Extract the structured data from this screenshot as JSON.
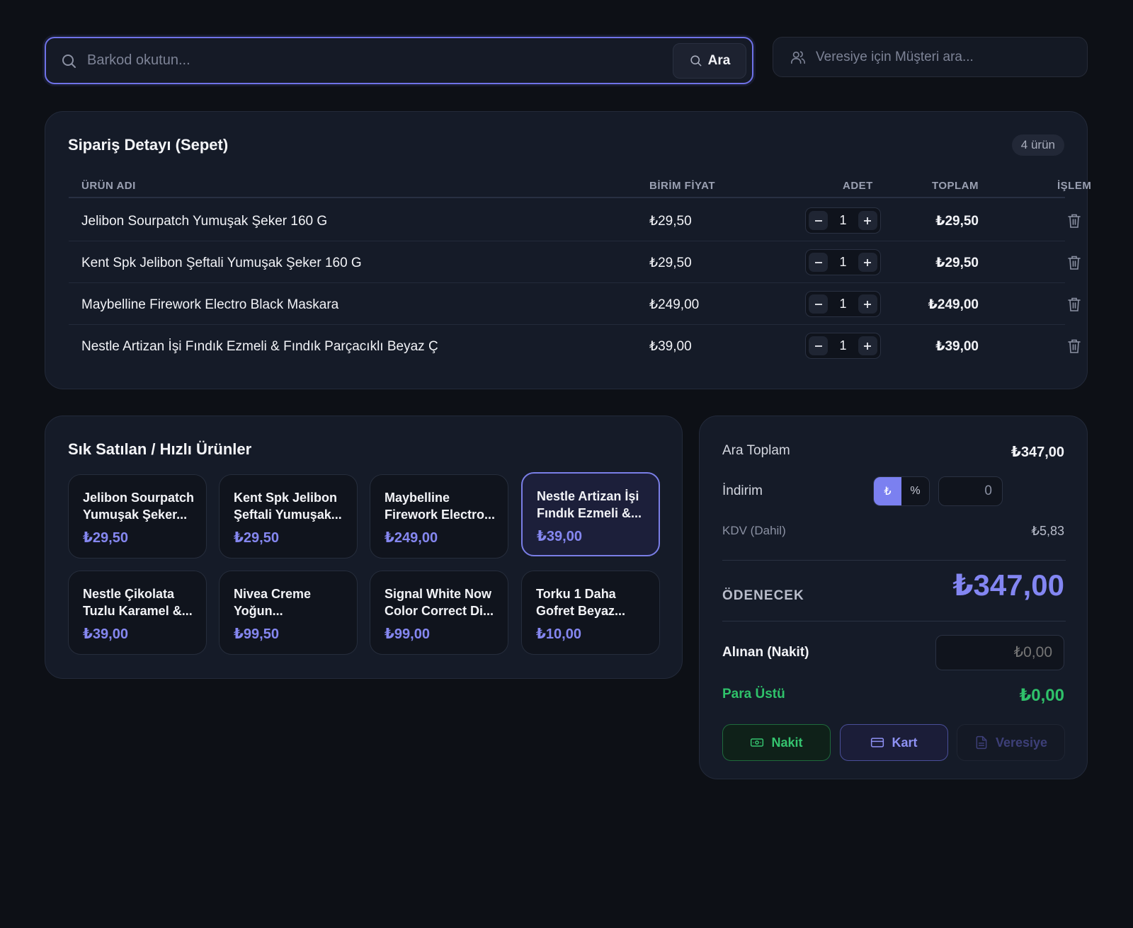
{
  "search": {
    "placeholder": "Barkod okutun...",
    "button_label": "Ara"
  },
  "customer": {
    "placeholder": "Veresiye için Müşteri ara..."
  },
  "cart": {
    "title": "Sipariş Detayı (Sepet)",
    "count_label": "4 ürün",
    "columns": {
      "name": "ÜRÜN ADI",
      "unit_price": "BİRİM FİYAT",
      "qty": "ADET",
      "total": "TOPLAM",
      "action": "İŞLEM"
    },
    "rows": [
      {
        "name": "Jelibon Sourpatch Yumuşak Şeker 160 G",
        "unit_price": "₺29,50",
        "qty": "1",
        "total": "₺29,50"
      },
      {
        "name": "Kent Spk Jelibon Şeftali Yumuşak Şeker 160 G",
        "unit_price": "₺29,50",
        "qty": "1",
        "total": "₺29,50"
      },
      {
        "name": "Maybelline Firework Electro Black Maskara",
        "unit_price": "₺249,00",
        "qty": "1",
        "total": "₺249,00"
      },
      {
        "name": "Nestle Artizan İşi Fındık Ezmeli & Fındık Parçacıklı Beyaz Ç",
        "unit_price": "₺39,00",
        "qty": "1",
        "total": "₺39,00"
      }
    ]
  },
  "quick": {
    "title": "Sık Satılan / Hızlı Ürünler",
    "products": [
      {
        "name": "Jelibon Sourpatch Yumuşak Şeker...",
        "price": "₺29,50"
      },
      {
        "name": "Kent Spk Jelibon Şeftali Yumuşak...",
        "price": "₺29,50"
      },
      {
        "name": "Maybelline Firework Electro...",
        "price": "₺249,00"
      },
      {
        "name": "Nestle Artizan İşi Fındık Ezmeli &...",
        "price": "₺39,00"
      },
      {
        "name": "Nestle Çikolata Tuzlu Karamel &...",
        "price": "₺39,00"
      },
      {
        "name": "Nivea Creme Yoğun...",
        "price": "₺99,50"
      },
      {
        "name": "Signal White Now Color Correct Di...",
        "price": "₺99,00"
      },
      {
        "name": "Torku 1 Daha Gofret Beyaz...",
        "price": "₺10,00"
      }
    ]
  },
  "summary": {
    "subtotal_label": "Ara Toplam",
    "subtotal_value": "₺347,00",
    "discount_label": "İndirim",
    "discount_toggle_currency": "₺",
    "discount_toggle_percent": "%",
    "discount_value": "0",
    "tax_label": "KDV (Dahil)",
    "tax_value": "₺5,83",
    "due_label": "ÖDENECEK",
    "due_value": "₺347,00",
    "cash_label": "Alınan (Nakit)",
    "cash_placeholder": "₺0,00",
    "change_label": "Para Üstü",
    "change_value": "₺0,00",
    "pay_cash": "Nakit",
    "pay_card": "Kart",
    "pay_credit": "Veresiye"
  },
  "colors": {
    "accent": "#7b80f0",
    "success": "#2fc26a",
    "background": "#0d1016",
    "panel": "#151b28"
  }
}
